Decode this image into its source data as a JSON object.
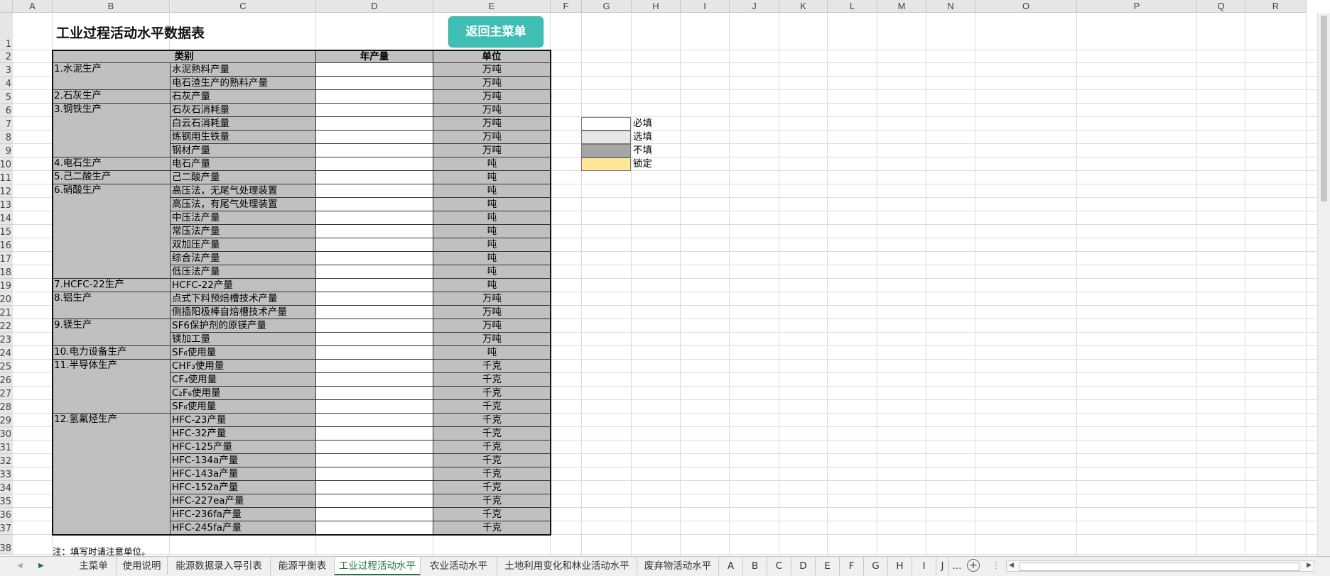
{
  "sheet": {
    "title": "工业过程活动水平数据表",
    "return_button": "返回主菜单",
    "columns": [
      "A",
      "B",
      "C",
      "D",
      "E",
      "F",
      "G",
      "H",
      "I",
      "J",
      "K",
      "L",
      "M",
      "N",
      "O",
      "P",
      "Q",
      "R"
    ],
    "headers": {
      "category": "类别",
      "annual_output": "年产量",
      "unit": "单位"
    },
    "groups": [
      {
        "name": "1.水泥生产",
        "items": [
          {
            "label": "水泥熟料产量",
            "unit": "万吨"
          },
          {
            "label": "电石渣生产的熟料产量",
            "unit": "万吨"
          }
        ]
      },
      {
        "name": "2.石灰生产",
        "items": [
          {
            "label": "石灰产量",
            "unit": "万吨"
          }
        ]
      },
      {
        "name": "3.钢铁生产",
        "items": [
          {
            "label": "石灰石消耗量",
            "unit": "万吨"
          },
          {
            "label": "白云石消耗量",
            "unit": "万吨"
          },
          {
            "label": "炼钢用生铁量",
            "unit": "万吨"
          },
          {
            "label": "钢材产量",
            "unit": "万吨"
          }
        ]
      },
      {
        "name": "4.电石生产",
        "items": [
          {
            "label": "电石产量",
            "unit": "吨"
          }
        ]
      },
      {
        "name": "5.己二酸生产",
        "items": [
          {
            "label": "己二酸产量",
            "unit": "吨"
          }
        ]
      },
      {
        "name": "6.硝酸生产",
        "items": [
          {
            "label": "高压法，无尾气处理装置",
            "unit": "吨"
          },
          {
            "label": "高压法，有尾气处理装置",
            "unit": "吨"
          },
          {
            "label": "中压法产量",
            "unit": "吨"
          },
          {
            "label": "常压法产量",
            "unit": "吨"
          },
          {
            "label": "双加压产量",
            "unit": "吨"
          },
          {
            "label": "综合法产量",
            "unit": "吨"
          },
          {
            "label": "低压法产量",
            "unit": "吨"
          }
        ]
      },
      {
        "name": "7.HCFC-22生产",
        "items": [
          {
            "label": "HCFC-22产量",
            "unit": "吨"
          }
        ]
      },
      {
        "name": "8.铝生产",
        "items": [
          {
            "label": "点式下料预焙槽技术产量",
            "unit": "万吨"
          },
          {
            "label": "侧插阳极棒自焙槽技术产量",
            "unit": "万吨"
          }
        ]
      },
      {
        "name": "9.镁生产",
        "items": [
          {
            "label": "SF6保护剂的原镁产量",
            "unit": "万吨"
          },
          {
            "label": "镁加工量",
            "unit": "万吨"
          }
        ]
      },
      {
        "name": "10.电力设备生产",
        "items": [
          {
            "label": "SF₆使用量",
            "unit": "吨"
          }
        ]
      },
      {
        "name": "11.半导体生产",
        "items": [
          {
            "label": "CHF₃使用量",
            "unit": "千克"
          },
          {
            "label": "CF₄使用量",
            "unit": "千克"
          },
          {
            "label": "C₂F₆使用量",
            "unit": "千克"
          },
          {
            "label": "SF₆使用量",
            "unit": "千克"
          }
        ]
      },
      {
        "name": "12.氢氟烃生产",
        "items": [
          {
            "label": "HFC-23产量",
            "unit": "千克"
          },
          {
            "label": "HFC-32产量",
            "unit": "千克"
          },
          {
            "label": "HFC-125产量",
            "unit": "千克"
          },
          {
            "label": "HFC-134a产量",
            "unit": "千克"
          },
          {
            "label": "HFC-143a产量",
            "unit": "千克"
          },
          {
            "label": "HFC-152a产量",
            "unit": "千克"
          },
          {
            "label": "HFC-227ea产量",
            "unit": "千克"
          },
          {
            "label": "HFC-236fa产量",
            "unit": "千克"
          },
          {
            "label": "HFC-245fa产量",
            "unit": "千克"
          }
        ]
      }
    ],
    "note": "注：填写时请注意单位。",
    "legend": [
      {
        "label": "必填",
        "color": "#ffffff"
      },
      {
        "label": "选填",
        "color": "#e6e6e6"
      },
      {
        "label": "不填",
        "color": "#a6a6a6"
      },
      {
        "label": "锁定",
        "color": "#ffe699"
      }
    ]
  },
  "tabs": [
    "主菜单",
    "使用说明",
    "能源数据录入导引表",
    "能源平衡表",
    "工业过程活动水平",
    "农业活动水平",
    "土地利用变化和林业活动水平",
    "废弃物活动水平",
    "A",
    "B",
    "C",
    "D",
    "E",
    "F",
    "G",
    "H",
    "I",
    "J",
    "..."
  ],
  "active_tab": "工业过程活动水平",
  "nav_icons": [
    "prev-sheet-icon",
    "next-sheet-icon",
    "add-sheet-icon",
    "scroll-left-icon",
    "scroll-right-icon"
  ]
}
